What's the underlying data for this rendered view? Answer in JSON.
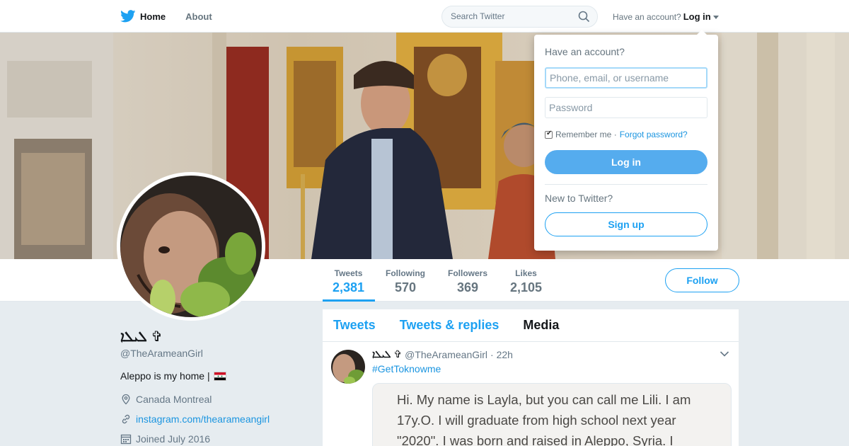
{
  "nav": {
    "home_label": "Home",
    "about_label": "About",
    "search_placeholder": "Search Twitter",
    "have_account": "Have an account?",
    "login_label": "Log in"
  },
  "profile": {
    "display_name": "ܠܝܠܐ ✞",
    "handle": "@TheArameanGirl",
    "bio": "Aleppo is my home |",
    "location": "Canada Montreal",
    "website": "instagram.com/thearameangirl",
    "joined": "Joined July 2016",
    "follow_label": "Follow"
  },
  "stats": [
    {
      "label": "Tweets",
      "value": "2,381"
    },
    {
      "label": "Following",
      "value": "570"
    },
    {
      "label": "Followers",
      "value": "369"
    },
    {
      "label": "Likes",
      "value": "2,105"
    }
  ],
  "tabs": [
    "Tweets",
    "Tweets & replies",
    "Media"
  ],
  "tweet": {
    "name": "ܠܝܠܐ ✞",
    "handle": "@TheArameanGirl",
    "time": "· 22h",
    "hashtag": "#GetToknowme",
    "image_text": [
      "Hi. My name is Layla, but you can call me Lili. I am",
      "17y.O. I will graduate from high school next year",
      "\"2020\". I was born and raised in Aleppo, Syria. I"
    ]
  },
  "login_dropdown": {
    "title": "Have an account?",
    "username_placeholder": "Phone, email, or username",
    "password_placeholder": "Password",
    "remember_me": "Remember me ·",
    "forgot_password": "Forgot password?",
    "login_button": "Log in",
    "new_to": "New to Twitter?",
    "signup_button": "Sign up"
  },
  "colors": {
    "accent": "#1da1f2",
    "link": "#1b95e0",
    "login_button": "#55acee",
    "background": "#e6ecf0"
  },
  "icons": [
    "twitter-bird-icon",
    "magnifier-icon",
    "location-pin-icon",
    "link-icon",
    "calendar-icon",
    "chevron-down-icon",
    "syria-flag-icon"
  ]
}
